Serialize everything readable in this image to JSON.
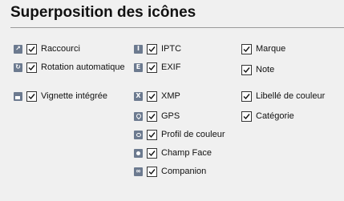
{
  "panel": {
    "title": "Superposition des icônes"
  },
  "options": {
    "col1": [
      {
        "label": "Raccourci",
        "icon": "shortcut-overlay-icon",
        "checked": true
      },
      {
        "label": "Rotation automatique",
        "icon": "rotation-overlay-icon",
        "checked": true
      },
      {
        "label": "Vignette intégrée",
        "icon": "thumbnail-overlay-icon",
        "checked": true
      }
    ],
    "col2": [
      {
        "label": "IPTC",
        "icon": "iptc-overlay-icon",
        "glyph": "I",
        "checked": true
      },
      {
        "label": "EXIF",
        "icon": "exif-overlay-icon",
        "glyph": "E",
        "checked": true
      },
      {
        "label": "XMP",
        "icon": "xmp-overlay-icon",
        "glyph": "X",
        "checked": true
      },
      {
        "label": "GPS",
        "icon": "gps-overlay-icon",
        "checked": true
      },
      {
        "label": "Profil de couleur",
        "icon": "color-profile-overlay-icon",
        "checked": true
      },
      {
        "label": "Champ Face",
        "icon": "face-field-overlay-icon",
        "checked": true
      },
      {
        "label": "Companion",
        "icon": "companion-overlay-icon",
        "checked": true
      }
    ],
    "col3": [
      {
        "label": "Marque",
        "checked": true
      },
      {
        "label": "Note",
        "checked": true
      },
      {
        "label": "Libellé de couleur",
        "checked": true
      },
      {
        "label": "Catégorie",
        "checked": true
      }
    ]
  },
  "colors": {
    "overlay_icon": "#6c7a8f",
    "background": "#f0f0f0"
  }
}
